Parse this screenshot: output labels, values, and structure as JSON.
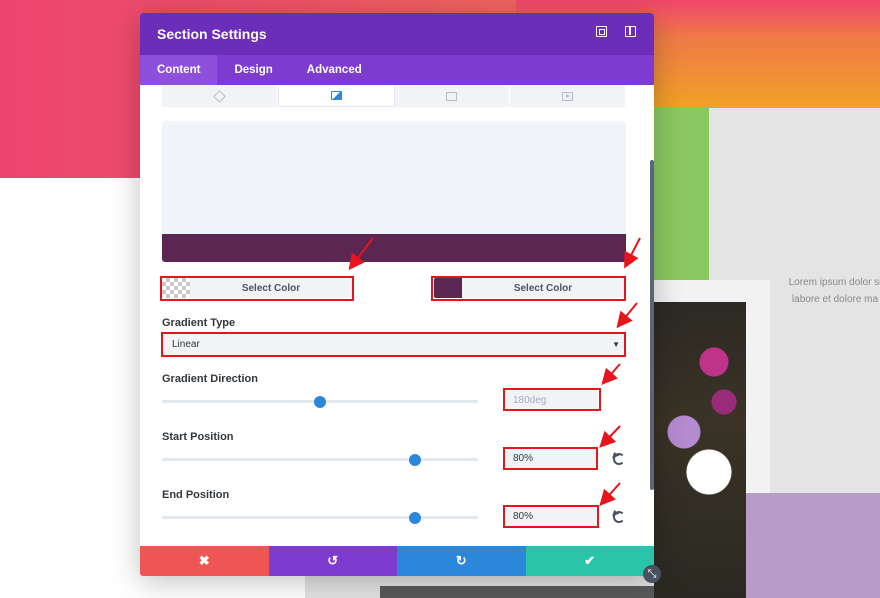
{
  "background": {
    "lorem_line1": "Lorem ipsum dolor si",
    "lorem_line2": "labore et dolore ma"
  },
  "modal": {
    "title": "Section Settings",
    "header_icons": [
      "fullscreen-icon",
      "split-view-icon"
    ],
    "tabs": [
      {
        "label": "Content",
        "active": true
      },
      {
        "label": "Design",
        "active": false
      },
      {
        "label": "Advanced",
        "active": false
      }
    ],
    "background_subtabs": [
      "paint-bucket-icon",
      "gradient-icon",
      "image-icon",
      "video-icon"
    ],
    "active_subtab": "gradient-icon",
    "gradient": {
      "start_color": "#ffffff",
      "end_color": "#5b2752",
      "start_color_label": "Select Color",
      "end_color_label": "Select Color",
      "type_label": "Gradient Type",
      "type_value": "Linear",
      "direction_label": "Gradient Direction",
      "direction_value": "180deg",
      "direction_fraction": 0.5,
      "start_label": "Start Position",
      "start_value": "80%",
      "start_fraction": 0.8,
      "end_label": "End Position",
      "end_value": "80%",
      "end_fraction": 0.8
    },
    "footer": {
      "cancel": "✖",
      "undo": "↺",
      "redo": "↻",
      "save": "✔"
    }
  },
  "colors": {
    "header": "#6c2eb9",
    "tabs": "#7e3bd0",
    "accent": "#2b87da",
    "annotation": "#e8141c"
  }
}
